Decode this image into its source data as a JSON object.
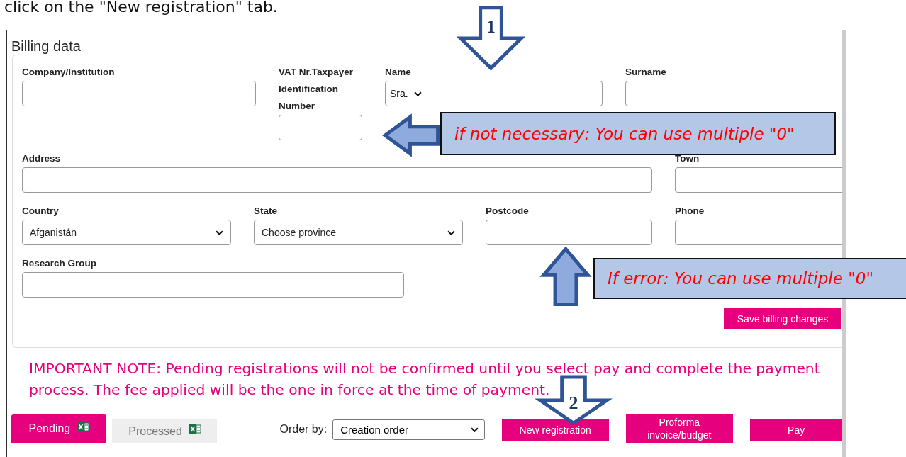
{
  "instruction": "click on the \"New registration\" tab.",
  "billing": {
    "title": "Billing data",
    "rows": [
      [
        {
          "label": "Company/Institution",
          "kind": "text"
        },
        {
          "label": "VAT Nr.Taxpayer Identification Number",
          "kind": "text"
        },
        {
          "label": "Name",
          "kind": "name",
          "prefix": "Sra."
        },
        {
          "label": "Surname",
          "kind": "text"
        }
      ],
      [
        {
          "label": "Address",
          "kind": "text"
        },
        {
          "label": "Town",
          "kind": "text"
        }
      ],
      [
        {
          "label": "Country",
          "kind": "select",
          "value": "Afganistán"
        },
        {
          "label": "State",
          "kind": "select",
          "value": "Choose province"
        },
        {
          "label": "Postcode",
          "kind": "text"
        },
        {
          "label": "Phone",
          "kind": "text"
        }
      ],
      [
        {
          "label": "Research Group",
          "kind": "text"
        }
      ]
    ],
    "save_button": "Save billing changes"
  },
  "note": "IMPORTANT NOTE: Pending registrations will not be confirmed until you select pay and complete the payment process. The fee applied will be the one in force at the time of payment.",
  "tabs": [
    {
      "label": "Pending",
      "selected": true
    },
    {
      "label": "Processed",
      "selected": false
    }
  ],
  "order_by": {
    "label": "Order by:",
    "value": "Creation order"
  },
  "buttons": [
    "New registration",
    "Proforma invoice/budget",
    "Pay"
  ],
  "annotations": [
    {
      "kind": "down-arrow",
      "label": "1"
    },
    {
      "kind": "left-arrow"
    },
    {
      "kind": "callout",
      "text": "if not necessary: You can use multiple \"0\""
    },
    {
      "kind": "up-arrow"
    },
    {
      "kind": "callout",
      "text": "If error: You can use multiple \"0\""
    },
    {
      "kind": "down-arrow",
      "label": "2"
    }
  ]
}
